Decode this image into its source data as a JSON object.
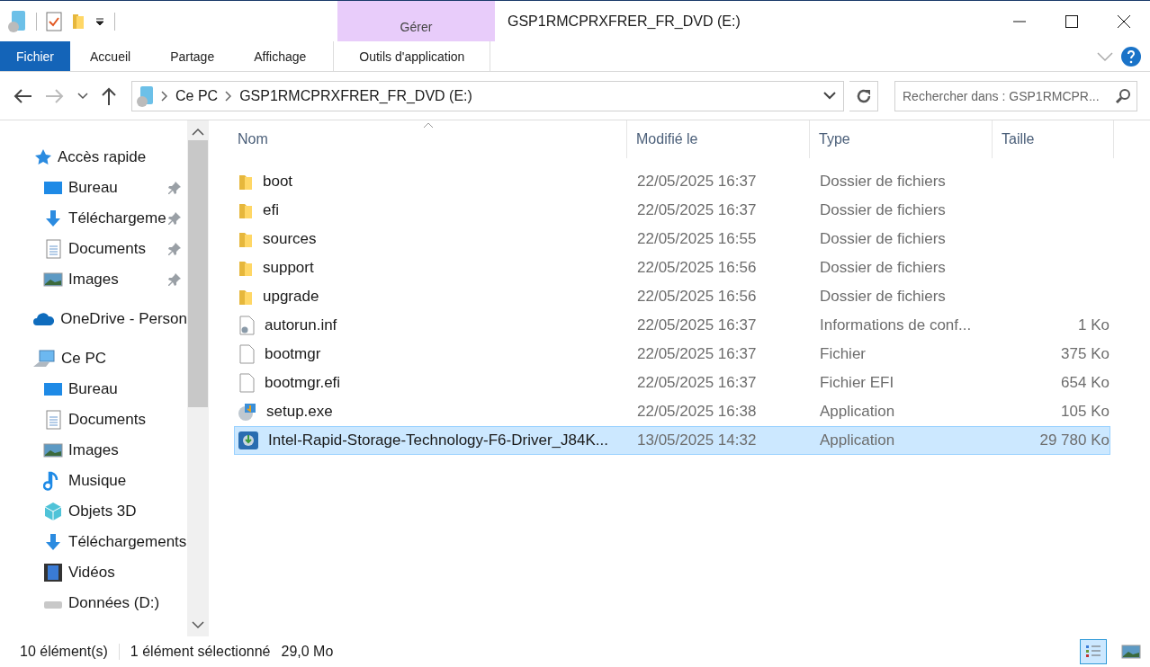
{
  "window": {
    "title": "GSP1RMCPRXFRER_FR_DVD (E:)",
    "context_tab": "Gérer"
  },
  "ribbon_tabs": [
    {
      "label": "Fichier",
      "kind": "file",
      "selected": false
    },
    {
      "label": "Accueil",
      "kind": "tab",
      "selected": false
    },
    {
      "label": "Partage",
      "kind": "tab",
      "selected": false
    },
    {
      "label": "Affichage",
      "kind": "tab",
      "selected": false
    },
    {
      "label": "Outils d'application",
      "kind": "context",
      "selected": false
    }
  ],
  "address": {
    "path": [
      "Ce PC",
      "GSP1RMCPRXFRER_FR_DVD (E:)"
    ]
  },
  "search": {
    "placeholder": "Rechercher dans : GSP1RMCPR..."
  },
  "nav": [
    {
      "label": "Accès rapide",
      "kind": "star",
      "children": [
        {
          "label": "Bureau",
          "kind": "desktop",
          "pinned": true
        },
        {
          "label": "Téléchargeme",
          "kind": "download",
          "pinned": true
        },
        {
          "label": "Documents",
          "kind": "doc",
          "pinned": true
        },
        {
          "label": "Images",
          "kind": "image",
          "pinned": true
        }
      ]
    },
    {
      "label": "OneDrive - Person",
      "kind": "cloud"
    },
    {
      "label": "Ce PC",
      "kind": "pc",
      "children": [
        {
          "label": "Bureau",
          "kind": "desktop",
          "pinned": false
        },
        {
          "label": "Documents",
          "kind": "doc",
          "pinned": false
        },
        {
          "label": "Images",
          "kind": "image",
          "pinned": false
        },
        {
          "label": "Musique",
          "kind": "music",
          "pinned": false
        },
        {
          "label": "Objets 3D",
          "kind": "cube",
          "pinned": false
        },
        {
          "label": "Téléchargements",
          "kind": "download",
          "pinned": false
        },
        {
          "label": "Vidéos",
          "kind": "video",
          "pinned": false
        },
        {
          "label": "Données (D:)",
          "kind": "drive",
          "pinned": false
        }
      ]
    }
  ],
  "table": {
    "columns": [
      "Nom",
      "Modifié le",
      "Type",
      "Taille"
    ],
    "rows": [
      {
        "name": "boot",
        "modified": "22/05/2025 16:37",
        "type": "Dossier de fichiers",
        "kind": "folder",
        "selected": false
      },
      {
        "name": "efi",
        "modified": "22/05/2025 16:37",
        "type": "Dossier de fichiers",
        "kind": "folder",
        "selected": false
      },
      {
        "name": "sources",
        "modified": "22/05/2025 16:55",
        "type": "Dossier de fichiers",
        "kind": "folder",
        "selected": false
      },
      {
        "name": "support",
        "modified": "22/05/2025 16:56",
        "type": "Dossier de fichiers",
        "kind": "folder",
        "selected": false
      },
      {
        "name": "upgrade",
        "modified": "22/05/2025 16:56",
        "type": "Dossier de fichiers",
        "kind": "folder",
        "selected": false
      },
      {
        "name": "autorun.inf",
        "modified": "22/05/2025 16:37",
        "type": "Informations de conf...",
        "size": "1 Ko",
        "kind": "config",
        "selected": false
      },
      {
        "name": "bootmgr",
        "modified": "22/05/2025 16:37",
        "type": "Fichier",
        "size": "375 Ko",
        "kind": "file",
        "selected": false
      },
      {
        "name": "bootmgr.efi",
        "modified": "22/05/2025 16:37",
        "type": "Fichier EFI",
        "size": "654 Ko",
        "kind": "file",
        "selected": false
      },
      {
        "name": "setup.exe",
        "modified": "22/05/2025 16:38",
        "type": "Application",
        "size": "105 Ko",
        "kind": "setup",
        "selected": false
      },
      {
        "name": "Intel-Rapid-Storage-Technology-F6-Driver_J84K...",
        "modified": "13/05/2025 14:32",
        "type": "Application",
        "size": "29 780 Ko",
        "kind": "installer",
        "selected": true
      }
    ]
  },
  "status_bar": {
    "count": "10 élément(s)",
    "selection": "1 élément sélectionné",
    "size": "29,0 Mo"
  },
  "view_buttons": [
    {
      "kind": "details",
      "selected": true
    },
    {
      "kind": "thumbnails",
      "selected": false
    }
  ]
}
